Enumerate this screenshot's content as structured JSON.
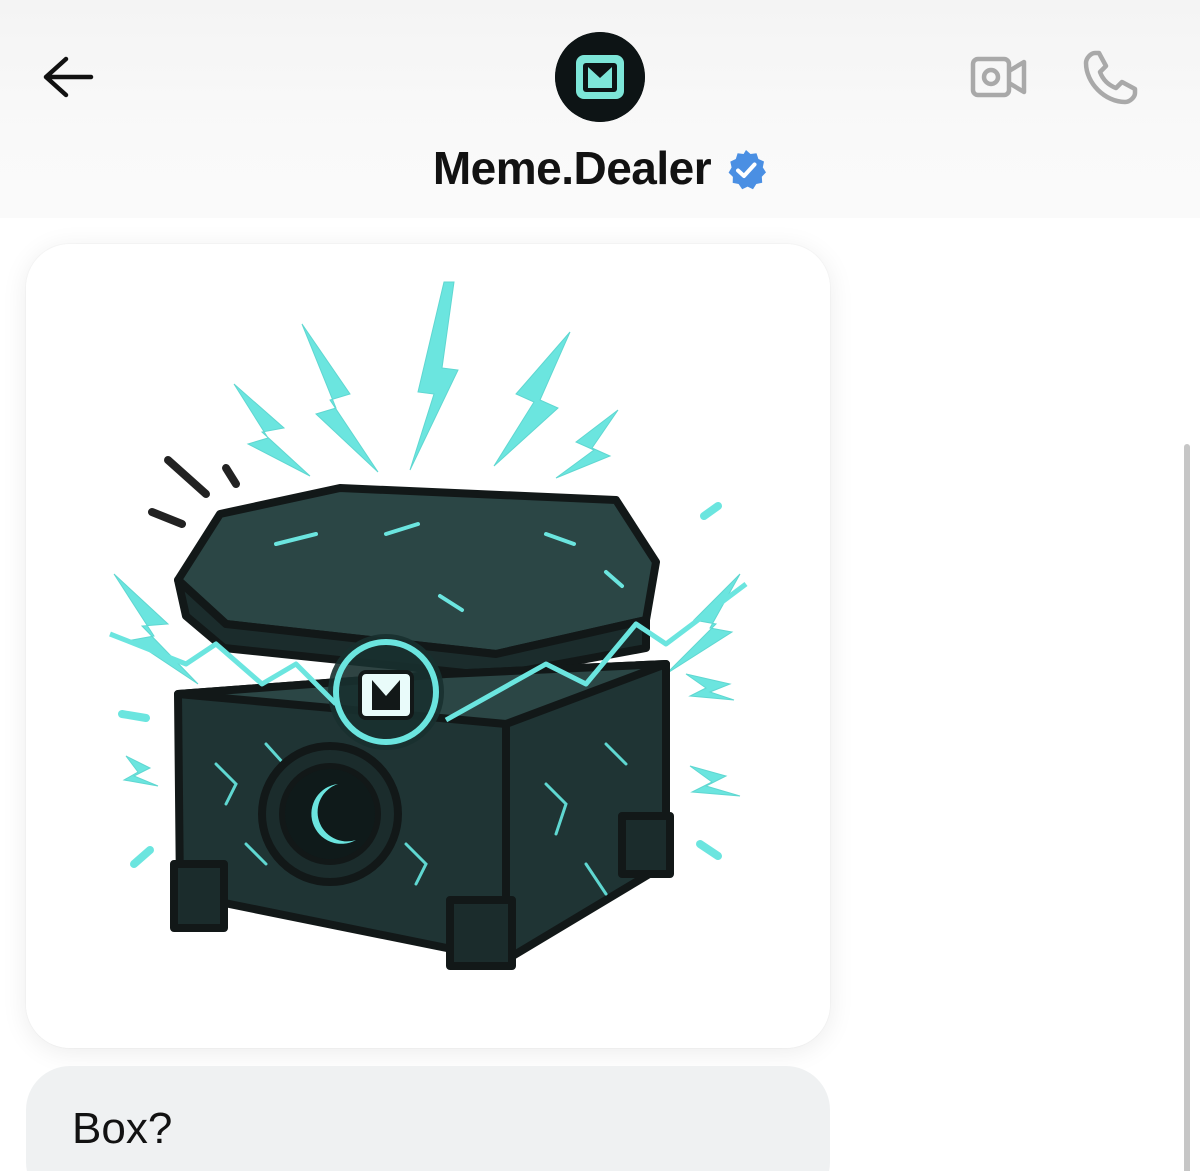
{
  "header": {
    "contact_name": "Meme.Dealer",
    "verified": true,
    "avatar_icon": "meme-dealer-logo-icon",
    "back_icon": "arrow-left-icon",
    "video_icon": "video-camera-icon",
    "call_icon": "phone-icon"
  },
  "messages": [
    {
      "type": "image",
      "content": "illustration of a dark open treasure chest emitting cyan lightning"
    },
    {
      "type": "text",
      "text": "Box?"
    }
  ],
  "colors": {
    "verified_blue": "#4a8fe3",
    "accent_cyan": "#6be5df",
    "chest_dark": "#1f3434",
    "icon_gray": "#a9a9a9",
    "received_bubble": "#eff1f2"
  }
}
